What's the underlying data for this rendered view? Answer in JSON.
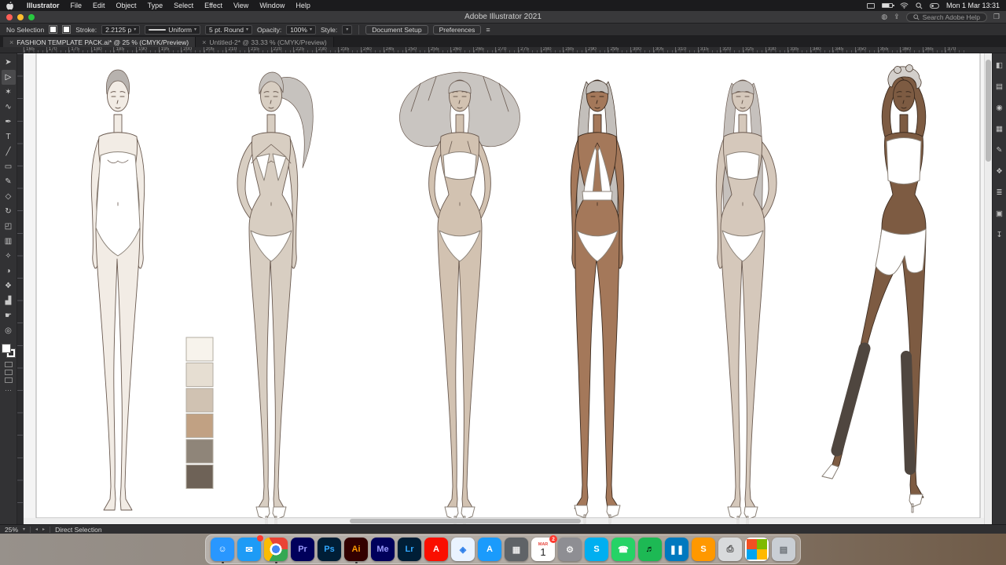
{
  "menu_bar": {
    "app_menu": "Illustrator",
    "items": [
      "Illustrator",
      "File",
      "Edit",
      "Object",
      "Type",
      "Select",
      "Effect",
      "View",
      "Window",
      "Help"
    ],
    "status_icons": [
      "display",
      "battery",
      "wifi",
      "control-center",
      "search"
    ],
    "clock": "Mon 1 Mar 13:31"
  },
  "title_bar": {
    "title": "Adobe Illustrator 2021",
    "search_placeholder": "Search Adobe Help"
  },
  "control_bar": {
    "selection_status": "No Selection",
    "stroke_label": "Stroke:",
    "stroke_value": "2.2125 p",
    "profile_value": "Uniform",
    "brush_value": "5 pt. Round",
    "opacity_label": "Opacity:",
    "opacity_value": "100%",
    "style_label": "Style:",
    "document_setup_label": "Document Setup",
    "preferences_label": "Preferences"
  },
  "tabs": [
    {
      "label": "FASHION TEMPLATE PACK.ai* @ 25 % (CMYK/Preview)",
      "active": true
    },
    {
      "label": "Untitled-2* @ 33.33 % (CMYK/Preview)",
      "active": false
    }
  ],
  "ruler": {
    "ticks": [
      165,
      170,
      175,
      180,
      185,
      190,
      195,
      200,
      205,
      210,
      215,
      220,
      225,
      230,
      235,
      240,
      245,
      250,
      255,
      260,
      265,
      270,
      275,
      280,
      285,
      290,
      295,
      300,
      305,
      310,
      315,
      320,
      325,
      330,
      335,
      340,
      345,
      350,
      355,
      360,
      365,
      370
    ]
  },
  "toolbar": {
    "tools": [
      {
        "name": "selection-tool",
        "glyph": "➤"
      },
      {
        "name": "direct-selection-tool",
        "glyph": "▷",
        "active": true
      },
      {
        "name": "magic-wand-tool",
        "glyph": "✶"
      },
      {
        "name": "lasso-tool",
        "glyph": "∿"
      },
      {
        "name": "pen-tool",
        "glyph": "✒"
      },
      {
        "name": "type-tool",
        "glyph": "T"
      },
      {
        "name": "line-segment-tool",
        "glyph": "╱"
      },
      {
        "name": "rectangle-tool",
        "glyph": "▭"
      },
      {
        "name": "paintbrush-tool",
        "glyph": "✎"
      },
      {
        "name": "shaper-tool",
        "glyph": "◇"
      },
      {
        "name": "rotate-tool",
        "glyph": "↻"
      },
      {
        "name": "scale-tool",
        "glyph": "◰"
      },
      {
        "name": "gradient-tool",
        "glyph": "▥"
      },
      {
        "name": "eyedropper-tool",
        "glyph": "✧"
      },
      {
        "name": "blend-tool",
        "glyph": "◑"
      },
      {
        "name": "symbol-sprayer-tool",
        "glyph": "❖"
      },
      {
        "name": "graph-tool",
        "glyph": "▟"
      },
      {
        "name": "hand-tool",
        "glyph": "☛"
      },
      {
        "name": "zoom-tool",
        "glyph": "◎"
      }
    ]
  },
  "right_panels": [
    {
      "name": "properties",
      "glyph": "◧"
    },
    {
      "name": "libraries",
      "glyph": "▤"
    },
    {
      "name": "color",
      "glyph": "◉"
    },
    {
      "name": "swatches",
      "glyph": "▦"
    },
    {
      "name": "brushes",
      "glyph": "✎"
    },
    {
      "name": "symbols",
      "glyph": "❖"
    },
    {
      "name": "layers",
      "glyph": "≣"
    },
    {
      "name": "artboards",
      "glyph": "▣"
    },
    {
      "name": "asset-export",
      "glyph": "↧"
    }
  ],
  "status_bar": {
    "zoom": "25%",
    "tool_label": "Direct Selection"
  },
  "dock": {
    "apps": [
      {
        "name": "finder",
        "bg": "#2997ff",
        "fg": "#ffffff",
        "text": "☺",
        "running": true
      },
      {
        "name": "mail",
        "bg": "#1d9bf6",
        "fg": "#ffffff",
        "text": "✉",
        "badge": ""
      },
      {
        "name": "chrome",
        "kind": "chrome",
        "text": "",
        "running": true
      },
      {
        "name": "premiere-pro",
        "bg": "#00005b",
        "fg": "#9999ff",
        "text": "Pr"
      },
      {
        "name": "photoshop",
        "bg": "#001e36",
        "fg": "#31a8ff",
        "text": "Ps"
      },
      {
        "name": "illustrator",
        "bg": "#330000",
        "fg": "#ff9a00",
        "text": "Ai",
        "running": true
      },
      {
        "name": "media-encoder",
        "bg": "#00005b",
        "fg": "#9999ff",
        "text": "Me"
      },
      {
        "name": "lightroom",
        "bg": "#001e36",
        "fg": "#31a8ff",
        "text": "Lr"
      },
      {
        "name": "acrobat",
        "bg": "#fa0f00",
        "fg": "#ffffff",
        "text": "A"
      },
      {
        "name": "safari",
        "bg": "#eaf3ff",
        "fg": "#2b7de9",
        "text": "◈"
      },
      {
        "name": "app-store",
        "bg": "#1a9bfc",
        "fg": "#ffffff",
        "text": "A"
      },
      {
        "name": "launchpad",
        "bg": "#5f6367",
        "fg": "#e8e8e8",
        "text": "▦"
      },
      {
        "name": "calendar",
        "kind": "calendar",
        "month": "MAR",
        "day": "1",
        "badge": "2"
      },
      {
        "name": "system-preferences",
        "bg": "#8e8e93",
        "fg": "#f0f0f0",
        "text": "⚙"
      },
      {
        "name": "skype",
        "bg": "#00aff0",
        "fg": "#ffffff",
        "text": "S"
      },
      {
        "name": "whatsapp",
        "bg": "#25d366",
        "fg": "#ffffff",
        "text": "☎"
      },
      {
        "name": "spotify",
        "bg": "#1db954",
        "fg": "#000000",
        "text": "♬"
      },
      {
        "name": "trello",
        "bg": "#0079bf",
        "fg": "#ffffff",
        "text": "❚❚"
      },
      {
        "name": "sublime-text",
        "bg": "#ff9800",
        "fg": "#ffffff",
        "text": "S"
      },
      {
        "name": "printer",
        "bg": "#d8dadc",
        "fg": "#4a4a4a",
        "text": "⎙"
      },
      {
        "name": "office-grid",
        "kind": "grid",
        "text": ""
      },
      {
        "name": "trash",
        "bg": "#c9ced4",
        "fg": "#6a7076",
        "text": "▤"
      }
    ]
  },
  "canvas": {
    "colors": {
      "outline_light": "#6a5a50",
      "outline_dark": "#3c2b1f",
      "garment": "#ffffff",
      "garment_stroke": "#8b8278",
      "stocking": "#4f463f"
    },
    "figures": [
      {
        "name": "figure-1",
        "skin": "#f2ece5",
        "hair": "#b7b2ae",
        "pose": "standing, arms at sides",
        "outfit": "strapless one-piece"
      },
      {
        "name": "figure-2",
        "skin": "#d8cec2",
        "hair": "#c6c2be",
        "pose": "hand on hip, ponytail",
        "outfit": "halter bikini"
      },
      {
        "name": "figure-3",
        "skin": "#d2c2b1",
        "hair": "#c9c5c1",
        "pose": "arms bent, wide voluminous hair",
        "outfit": "bandeau bikini"
      },
      {
        "name": "figure-4",
        "skin": "#a4785a",
        "hair": "#c3bfbb",
        "pose": "legs apart, long straight hair",
        "outfit": "halter top and briefs"
      },
      {
        "name": "figure-5",
        "skin": "#d5c8bb",
        "hair": "#c6c1bd",
        "pose": "hand on hip, long wavy hair",
        "outfit": "strapless bandeau bikini"
      },
      {
        "name": "figure-6",
        "skin": "#7d5b42",
        "hair": "#d3cfcb",
        "pose": "arms raised overhead, leg extended",
        "outfit": "crop top, shorts and stockings"
      }
    ],
    "swatches": [
      "#f7f3ec",
      "#e6ded2",
      "#d0c2b2",
      "#c1a183",
      "#8f8579",
      "#6e6257"
    ]
  }
}
